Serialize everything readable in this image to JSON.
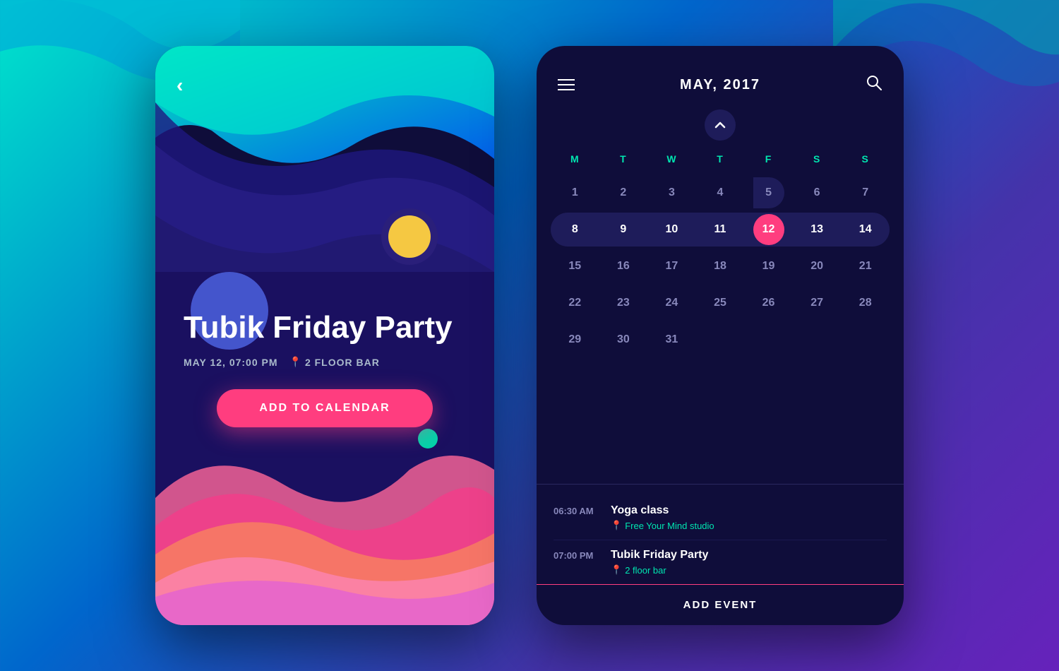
{
  "background": {
    "gradient_start": "#00e5cc",
    "gradient_end": "#6622bb"
  },
  "left_phone": {
    "back_button": "‹",
    "event_title": "Tubik Friday Party",
    "event_date": "MAY 12, 07:00 PM",
    "event_location": "2 FLOOR BAR",
    "add_to_calendar_label": "ADD TO CALENDAR",
    "colors": {
      "bg": "#1a1060",
      "button": "#ff3d7f",
      "yellow_circle": "#f5c842",
      "blue_circle": "#4455cc",
      "teal_dot": "#00d4aa"
    }
  },
  "right_calendar": {
    "menu_icon_label": "menu",
    "title": "MAY, 2017",
    "search_icon_label": "search",
    "nav_up": "^",
    "day_labels": [
      "M",
      "T",
      "W",
      "T",
      "F",
      "S",
      "S"
    ],
    "weeks": [
      [
        {
          "num": "",
          "empty": true
        },
        {
          "num": "",
          "empty": true
        },
        {
          "num": "",
          "empty": true
        },
        {
          "num": "",
          "empty": true
        },
        {
          "num": "5",
          "today": false,
          "selected": true
        },
        {
          "num": "6",
          "today": false
        },
        {
          "num": "7",
          "today": false
        }
      ],
      [
        {
          "num": "1",
          "today": false
        },
        {
          "num": "2",
          "today": false
        },
        {
          "num": "3",
          "today": false
        },
        {
          "num": "4",
          "today": false
        },
        {
          "num": "5",
          "today": false
        },
        {
          "num": "6",
          "today": false
        },
        {
          "num": "7",
          "today": false
        }
      ],
      [
        {
          "num": "8",
          "today": false,
          "selected_row": true
        },
        {
          "num": "9",
          "today": false,
          "selected_row": true
        },
        {
          "num": "10",
          "today": false,
          "selected_row": true
        },
        {
          "num": "11",
          "today": false,
          "selected_row": true
        },
        {
          "num": "12",
          "today": true,
          "selected_row": true
        },
        {
          "num": "13",
          "today": false,
          "selected_row": true
        },
        {
          "num": "14",
          "today": false,
          "selected_row": true
        }
      ],
      [
        {
          "num": "15",
          "today": false
        },
        {
          "num": "16",
          "today": false
        },
        {
          "num": "17",
          "today": false
        },
        {
          "num": "18",
          "today": false
        },
        {
          "num": "19",
          "today": false
        },
        {
          "num": "20",
          "today": false
        },
        {
          "num": "21",
          "today": false
        }
      ],
      [
        {
          "num": "22",
          "today": false
        },
        {
          "num": "23",
          "today": false
        },
        {
          "num": "24",
          "today": false
        },
        {
          "num": "25",
          "today": false
        },
        {
          "num": "26",
          "today": false
        },
        {
          "num": "27",
          "today": false
        },
        {
          "num": "28",
          "today": false
        }
      ],
      [
        {
          "num": "29",
          "today": false
        },
        {
          "num": "30",
          "today": false
        },
        {
          "num": "31",
          "today": false
        },
        {
          "num": "",
          "empty": true
        },
        {
          "num": "",
          "empty": true
        },
        {
          "num": "",
          "empty": true
        },
        {
          "num": "",
          "empty": true
        }
      ]
    ],
    "events": [
      {
        "time": "06:30 AM",
        "name": "Yoga class",
        "location": "Free Your Mind studio"
      },
      {
        "time": "07:00 PM",
        "name": "Tubik Friday Party",
        "location": "2 floor bar"
      }
    ],
    "add_event_label": "ADD EVENT",
    "colors": {
      "bg": "#0f0d3a",
      "row_highlight": "#1e1c5a",
      "today": "#ff3d7f",
      "accent": "#00e5b0"
    }
  }
}
